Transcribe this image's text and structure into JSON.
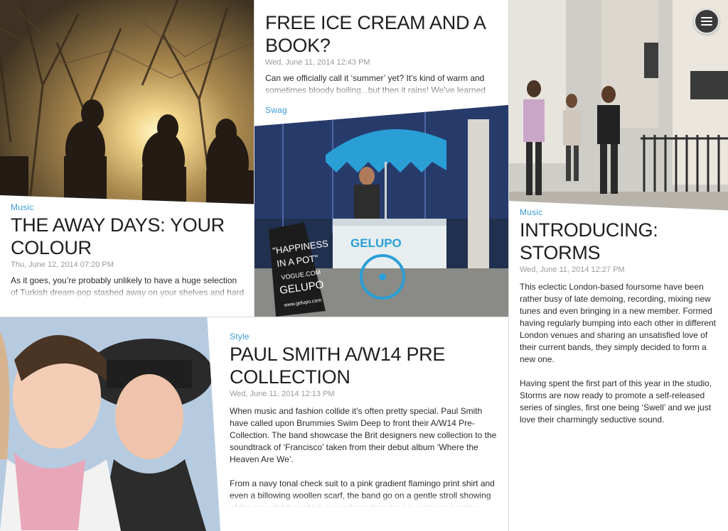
{
  "menu": {
    "icon": "hamburger-menu-icon"
  },
  "articles": {
    "away_days": {
      "category": "Music",
      "title": "THE AWAY DAYS: YOUR COLOUR",
      "date": "Thu, June 12, 2014 07:20 PM",
      "excerpt": "As it goes, you’re probably unlikely to have a huge selection of Turkish dream-pop stashed away on your shelves and hard"
    },
    "ice_cream": {
      "category": "Swag",
      "title": "FREE ICE CREAM AND A BOOK?",
      "date": "Wed, June 11, 2014 12:43 PM",
      "excerpt": "Can we officially call it ‘summer’ yet? It’s kind of warm and sometimes bloody boiling...but then it rains! We’ve learned",
      "cart_sign": "GELUPO",
      "board_line1": "\"HAPPINESS",
      "board_line2": "IN A POT\"",
      "board_line3": "VOGUE.COM",
      "board_line4": "GELUPO",
      "board_line5": "www.gelupo.com"
    },
    "storms": {
      "category": "Music",
      "title": "INTRODUCING: STORMS",
      "date": "Wed, June 11, 2014 12:27 PM",
      "paragraph1": "This eclectic London-based foursome have been rather busy of late demoing, recording, mixing new tunes and even bringing in a new member. Formed having regularly bumping into each other in different London venues and sharing an unsatisfied love of their current bands, they simply decided to form a new one.",
      "paragraph2": "Having spent the first part of this year in the studio, Storms are now ready to promote a self-released series of singles, first one being ‘Swell’ and we just love their charmingly seductive sound."
    },
    "paul_smith": {
      "category": "Style",
      "title": "PAUL SMITH A/W14 PRE COLLECTION",
      "date": "Wed, June 11, 2014 12:13 PM",
      "paragraph1": "When music and fashion collide it’s often pretty special. Paul Smith have called upon Brummies Swim Deep to front their A/W14 Pre-Collection. The band showcase the Brit designers new collection to the soundtrack of ‘Francisco’ taken from their debut album ‘Where the Heaven Are We’.",
      "paragraph2": "From a navy tonal check suit to a pink gradient flamingo print shirt and even a billowing woollen scarf, the band go on a gentle stroll showing of the new clobber which see’s them drenched in water and make"
    }
  }
}
